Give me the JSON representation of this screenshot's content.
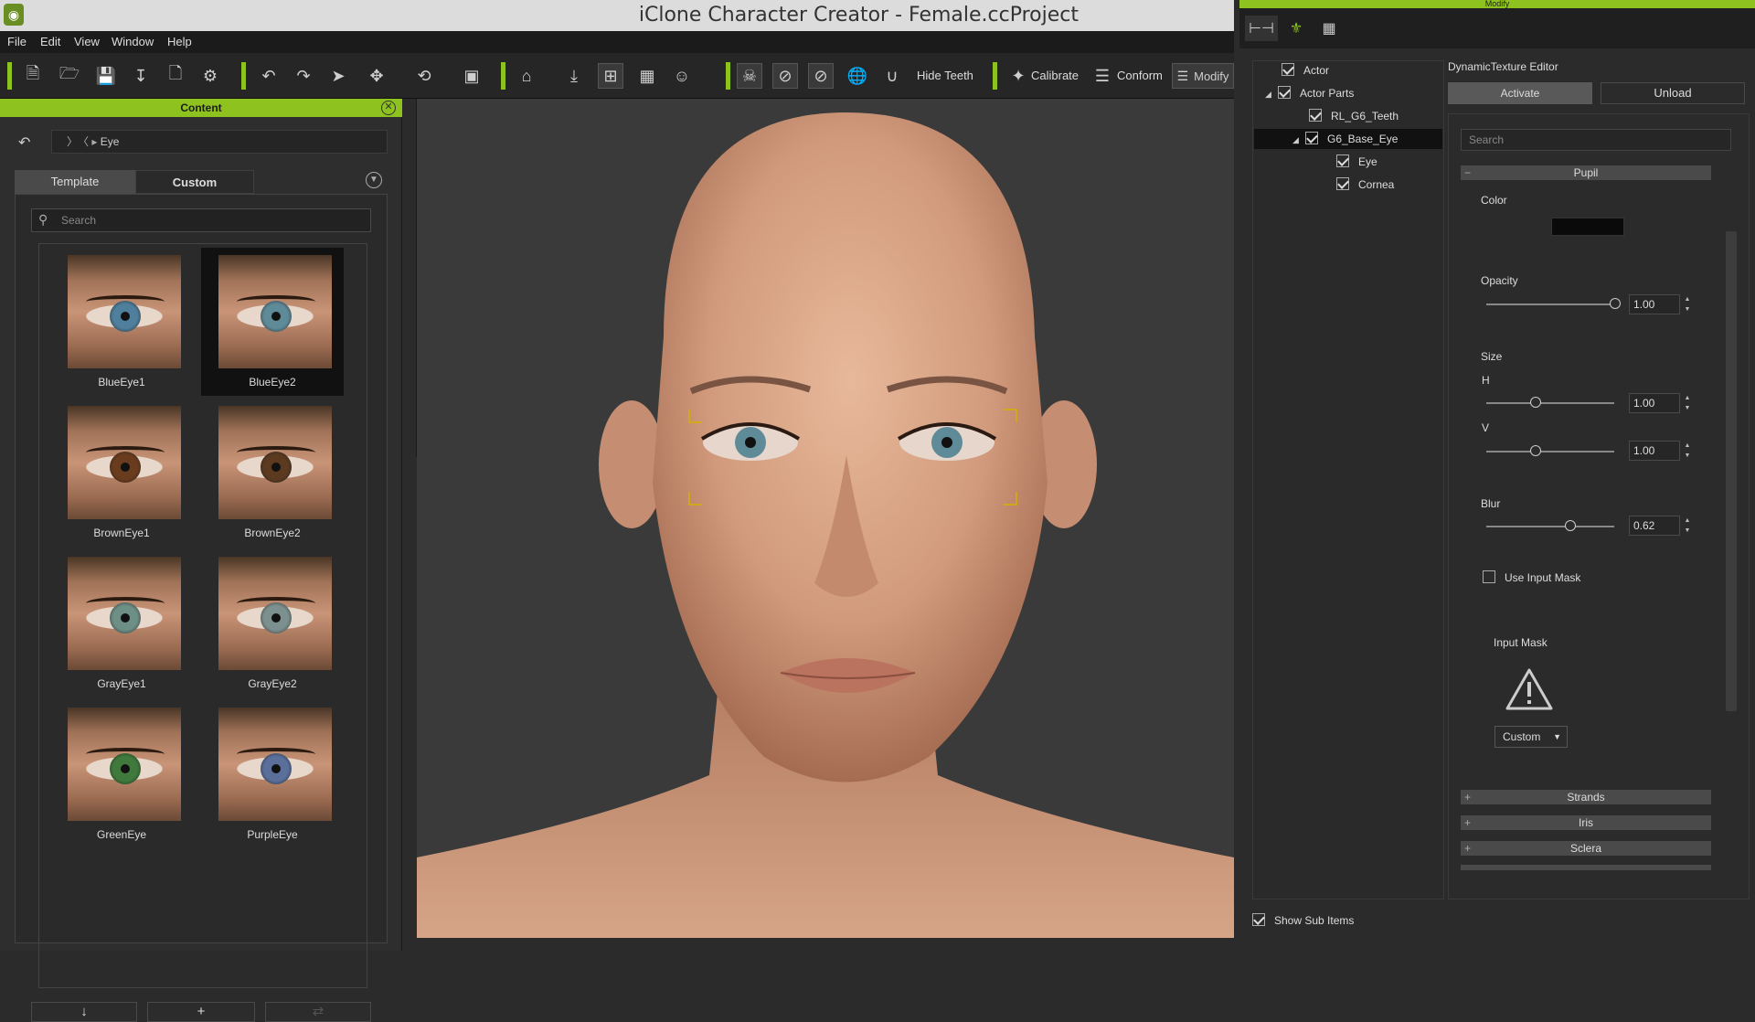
{
  "app": {
    "title": "iClone Character Creator - Female.ccProject"
  },
  "menu": [
    "File",
    "Edit",
    "View",
    "Window",
    "Help"
  ],
  "toolbar": {
    "hide_teeth": "Hide Teeth",
    "calibrate": "Calibrate",
    "conform": "Conform",
    "modify": "Modify"
  },
  "content": {
    "header": "Content",
    "breadcrumb": "Eye",
    "tabs": [
      "Template",
      "Custom"
    ],
    "search_placeholder": "Search",
    "items": [
      {
        "label": "BlueEye1",
        "iris": "#4f7f9c"
      },
      {
        "label": "BlueEye2",
        "iris": "#5f8a98"
      },
      {
        "label": "BrownEye1",
        "iris": "#6a3c1e"
      },
      {
        "label": "BrownEye2",
        "iris": "#5b3a20"
      },
      {
        "label": "GrayEye1",
        "iris": "#6e8f86"
      },
      {
        "label": "GrayEye2",
        "iris": "#7c918f"
      },
      {
        "label": "GreenEye",
        "iris": "#3f7a3c"
      },
      {
        "label": "PurpleEye",
        "iris": "#5a6f9a"
      }
    ],
    "selected_index": 1
  },
  "right": {
    "header": "Modify",
    "tree": {
      "actor": "Actor",
      "actor_parts": "Actor Parts",
      "teeth": "RL_G6_Teeth",
      "base_eye": "G6_Base_Eye",
      "eye": "Eye",
      "cornea": "Cornea"
    },
    "dte_title": "DynamicTexture Editor",
    "activate": "Activate",
    "unload": "Unload",
    "search_placeholder": "Search",
    "pupil": {
      "section": "Pupil",
      "color_label": "Color",
      "color": "#0a0a0a",
      "opacity_label": "Opacity",
      "opacity": "1.00",
      "size_label": "Size",
      "h_label": "H",
      "h": "1.00",
      "v_label": "V",
      "v": "1.00",
      "blur_label": "Blur",
      "blur": "0.62",
      "use_input_mask": "Use Input Mask",
      "input_mask_label": "Input Mask",
      "mask_dropdown": "Custom"
    },
    "sections": [
      "Strands",
      "Iris",
      "Sclera"
    ],
    "show_sub_items": "Show Sub Items"
  },
  "colors": {
    "accent": "#8dc21f"
  }
}
